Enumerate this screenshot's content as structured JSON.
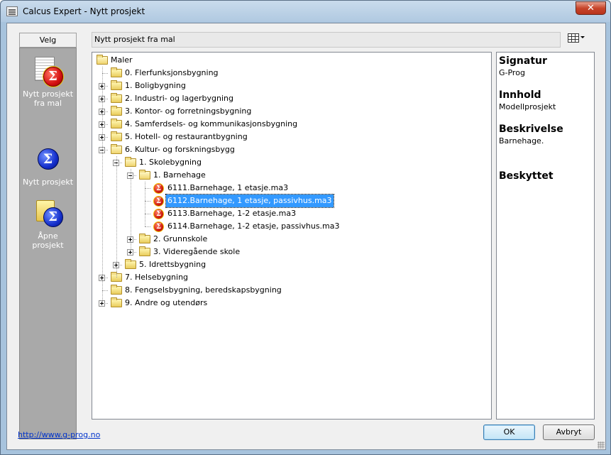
{
  "window": {
    "title": "Calcus Expert - Nytt prosjekt"
  },
  "left_panel": {
    "header": "Velg",
    "items": [
      {
        "label": "Nytt prosjekt fra mal",
        "icon": "template-sigma-icon"
      },
      {
        "label": "Nytt prosjekt",
        "icon": "sigma-icon"
      },
      {
        "label": "Åpne prosjekt",
        "icon": "folder-sigma-icon"
      }
    ]
  },
  "header_field": {
    "value": "Nytt prosjekt fra mal"
  },
  "tree": {
    "root": "Maler",
    "rows": [
      {
        "label": "0. Flerfunksjonsbygning",
        "level": 1,
        "type": "folder",
        "expander": "none"
      },
      {
        "label": "1. Boligbygning",
        "level": 1,
        "type": "folder",
        "expander": "plus"
      },
      {
        "label": "2. Industri- og lagerbygning",
        "level": 1,
        "type": "folder",
        "expander": "plus"
      },
      {
        "label": "3. Kontor- og forretningsbygning",
        "level": 1,
        "type": "folder",
        "expander": "plus"
      },
      {
        "label": "4. Samferdsels- og kommunikasjonsbygning",
        "level": 1,
        "type": "folder",
        "expander": "plus"
      },
      {
        "label": "5. Hotell- og restaurantbygning",
        "level": 1,
        "type": "folder",
        "expander": "plus"
      },
      {
        "label": "6. Kultur- og forskningsbygg",
        "level": 1,
        "type": "folder-open",
        "expander": "minus"
      },
      {
        "label": "1. Skolebygning",
        "level": 2,
        "type": "folder-open",
        "expander": "minus"
      },
      {
        "label": "1. Barnehage",
        "level": 3,
        "type": "folder-open",
        "expander": "minus"
      },
      {
        "label": "6111.Barnehage, 1 etasje.ma3",
        "level": 4,
        "type": "file",
        "expander": "none"
      },
      {
        "label": "6112.Barnehage, 1 etasje, passivhus.ma3",
        "level": 4,
        "type": "file",
        "expander": "none",
        "selected": true
      },
      {
        "label": "6113.Barnehage, 1-2 etasje.ma3",
        "level": 4,
        "type": "file",
        "expander": "none"
      },
      {
        "label": "6114.Barnehage, 1-2 etasje, passivhus.ma3",
        "level": 4,
        "type": "file",
        "expander": "none"
      },
      {
        "label": "2. Grunnskole",
        "level": 3,
        "type": "folder",
        "expander": "plus"
      },
      {
        "label": "3. Videregående skole",
        "level": 3,
        "type": "folder",
        "expander": "plus"
      },
      {
        "label": "5. Idrettsbygning",
        "level": 2,
        "type": "folder",
        "expander": "plus"
      },
      {
        "label": "7. Helsebygning",
        "level": 1,
        "type": "folder",
        "expander": "plus"
      },
      {
        "label": "8. Fengselsbygning, beredskapsbygning",
        "level": 1,
        "type": "folder",
        "expander": "none"
      },
      {
        "label": "9. Andre og utendørs",
        "level": 1,
        "type": "folder",
        "expander": "plus"
      }
    ]
  },
  "info": {
    "signatur_label": "Signatur",
    "signatur_value": "G-Prog",
    "innhold_label": "Innhold",
    "innhold_value": "Modellprosjekt",
    "beskrivelse_label": "Beskrivelse",
    "beskrivelse_value": "Barnehage.",
    "beskyttet_label": "Beskyttet"
  },
  "footer": {
    "link": "http://www.g-prog.no",
    "ok": "OK",
    "cancel": "Avbryt"
  },
  "icons": {
    "close": "close-icon",
    "view_menu": "grid-view-icon",
    "sigma_char": "Σ",
    "close_char": "✕"
  }
}
